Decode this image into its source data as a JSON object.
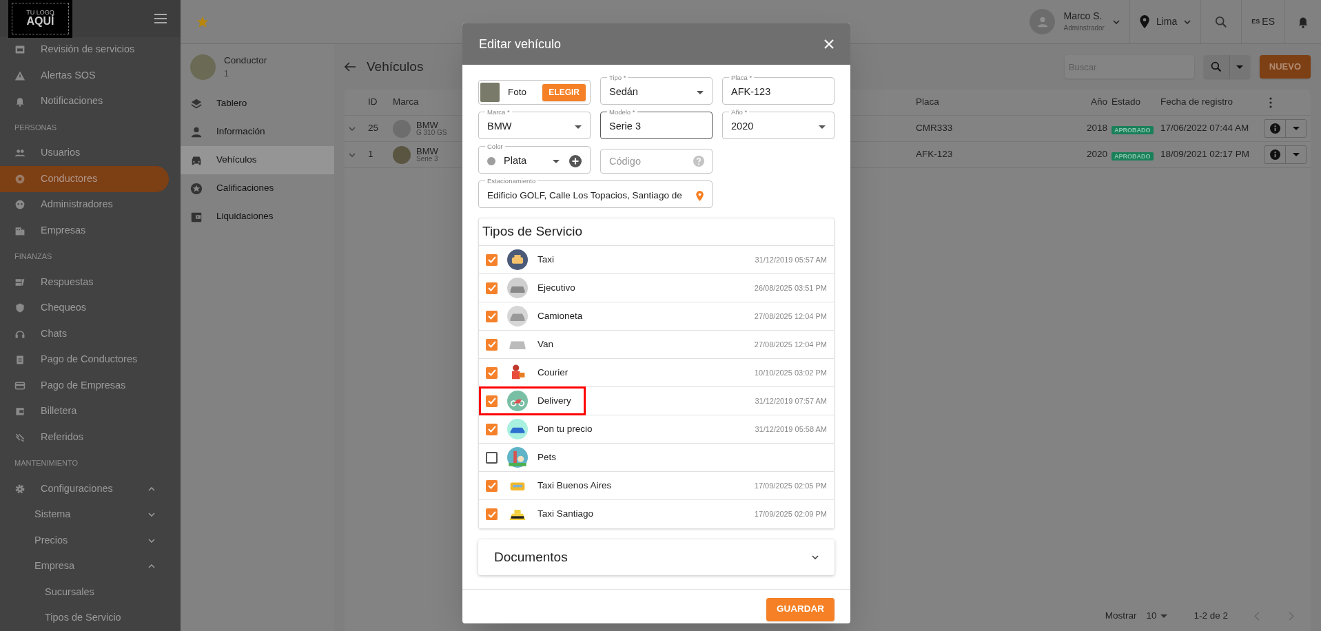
{
  "brand": {
    "line1": "TU LOGO",
    "line2": "AQUÍ"
  },
  "sidebar": {
    "items": [
      {
        "kind": "item",
        "label": "Revisión de servicios",
        "selected": false
      },
      {
        "kind": "item",
        "label": "Alertas SOS",
        "selected": false
      },
      {
        "kind": "item",
        "label": "Notificaciones",
        "selected": false
      },
      {
        "kind": "section",
        "label": "PERSONAS"
      },
      {
        "kind": "item",
        "label": "Usuarios",
        "selected": false
      },
      {
        "kind": "item",
        "label": "Conductores",
        "selected": true
      },
      {
        "kind": "item",
        "label": "Administradores",
        "selected": false
      },
      {
        "kind": "item",
        "label": "Empresas",
        "selected": false
      },
      {
        "kind": "section",
        "label": "FINANZAS"
      },
      {
        "kind": "item",
        "label": "Respuestas",
        "selected": false
      },
      {
        "kind": "item",
        "label": "Chequeos",
        "selected": false
      },
      {
        "kind": "item",
        "label": "Chats",
        "selected": false
      },
      {
        "kind": "item",
        "label": "Pago de Conductores",
        "selected": false
      },
      {
        "kind": "item",
        "label": "Pago de Empresas",
        "selected": false
      },
      {
        "kind": "item",
        "label": "Billetera",
        "selected": false
      },
      {
        "kind": "item",
        "label": "Referidos",
        "selected": false
      },
      {
        "kind": "section",
        "label": "MANTENIMIENTO"
      },
      {
        "kind": "group",
        "label": "Configuraciones",
        "selected": false,
        "expanded": true,
        "children": [
          {
            "label": "Sistema",
            "expanded": false
          },
          {
            "label": "Precios",
            "expanded": false
          },
          {
            "label": "Empresa",
            "expanded": true,
            "children": [
              {
                "label": "Sucursales"
              },
              {
                "label": "Tipos de Servicio"
              }
            ]
          }
        ]
      }
    ]
  },
  "topbar": {
    "user": {
      "name": "Marco S.",
      "role": "Adminstrador"
    },
    "location": "Lima",
    "language": {
      "flag": "ES",
      "code": "ES"
    }
  },
  "driver_panel": {
    "title": "Conductor",
    "subtitle": "1",
    "menu": [
      {
        "label": "Tablero",
        "selected": false
      },
      {
        "label": "Información",
        "selected": false
      },
      {
        "label": "Vehículos",
        "selected": true
      },
      {
        "label": "Calificaciones",
        "selected": false
      },
      {
        "label": "Liquidaciones",
        "selected": false
      }
    ]
  },
  "page": {
    "title": "Vehículos",
    "search": {
      "placeholder": "Buscar"
    },
    "new_button": "NUEVO",
    "table": {
      "columns": [
        "ID",
        "Marca",
        "Placa",
        "Año",
        "Estado",
        "Fecha de registro"
      ],
      "rows": [
        {
          "id": "25",
          "brand": "BMW",
          "model": "G 310 GS",
          "plate": "CMR333",
          "year": "2018",
          "status": "APROBADO",
          "date": "17/06/2022 07:44 AM"
        },
        {
          "id": "1",
          "brand": "BMW",
          "model": "Serie 3",
          "plate": "AFK-123",
          "year": "2020",
          "status": "APROBADO",
          "date": "18/09/2021 02:17 PM"
        }
      ]
    },
    "pagination": {
      "label": "Mostrar",
      "page_size": "10",
      "range": "1-2 de 2"
    }
  },
  "modal": {
    "title": "Editar vehículo",
    "photo": {
      "label": "Foto",
      "button": "ELEGIR"
    },
    "tipo": {
      "label": "Tipo *",
      "value": "Sedán"
    },
    "placa": {
      "label": "Placa *",
      "value": "AFK-123"
    },
    "marca": {
      "label": "Marca *",
      "value": "BMW"
    },
    "modelo": {
      "label": "Modelo *",
      "value": "Serie 3"
    },
    "anio": {
      "label": "Año *",
      "value": "2020"
    },
    "color": {
      "label": "Color",
      "value": "Plata"
    },
    "codigo": {
      "placeholder": "Código"
    },
    "estacionamiento": {
      "label": "Estacionamiento",
      "value": "Edificio GOLF, Calle Los Topacios, Santiago de"
    },
    "services": {
      "title": "Tipos de Servicio",
      "items": [
        {
          "name": "Taxi",
          "date": "31/12/2019 05:57 AM",
          "checked": true,
          "highlighted": false
        },
        {
          "name": "Ejecutivo",
          "date": "26/08/2025 03:51 PM",
          "checked": true,
          "highlighted": false
        },
        {
          "name": "Camioneta",
          "date": "27/08/2025 12:04 PM",
          "checked": true,
          "highlighted": false
        },
        {
          "name": "Van",
          "date": "27/08/2025 12:04 PM",
          "checked": true,
          "highlighted": false
        },
        {
          "name": "Courier",
          "date": "10/10/2025 03:02 PM",
          "checked": true,
          "highlighted": false
        },
        {
          "name": "Delivery",
          "date": "31/12/2019 07:57 AM",
          "checked": true,
          "highlighted": true
        },
        {
          "name": "Pon tu precio",
          "date": "31/12/2019 05:58 AM",
          "checked": true,
          "highlighted": false
        },
        {
          "name": "Pets",
          "checked": false,
          "highlighted": false
        },
        {
          "name": "Taxi Buenos Aires",
          "date": "17/09/2025 02:05 PM",
          "checked": true,
          "highlighted": false
        },
        {
          "name": "Taxi Santiago",
          "date": "17/09/2025 02:09 PM",
          "checked": true,
          "highlighted": false
        }
      ]
    },
    "documents": {
      "title": "Documentos",
      "expanded": false
    },
    "save_button": "GUARDAR"
  }
}
